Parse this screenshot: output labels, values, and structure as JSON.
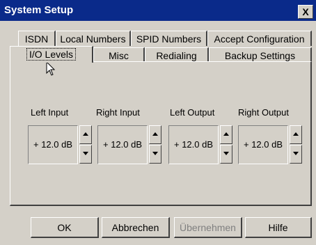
{
  "window": {
    "title": "System Setup",
    "close_glyph": "X"
  },
  "tabs_row1": [
    {
      "label": "ISDN"
    },
    {
      "label": "Local Numbers"
    },
    {
      "label": "SPID Numbers"
    },
    {
      "label": "Accept Configuration"
    }
  ],
  "tabs_row2": [
    {
      "label": "I/O Levels",
      "active": true
    },
    {
      "label": "Misc"
    },
    {
      "label": "Redialing"
    },
    {
      "label": "Backup Settings"
    }
  ],
  "channels": [
    {
      "label": "Left Input",
      "value": "+ 12.0 dB"
    },
    {
      "label": "Right Input",
      "value": "+ 12.0 dB"
    },
    {
      "label": "Left Output",
      "value": "+ 12.0 dB"
    },
    {
      "label": "Right Output",
      "value": "+ 12.0 dB"
    }
  ],
  "buttons": {
    "ok": "OK",
    "cancel": "Abbrechen",
    "apply": "Übernehmen",
    "help": "Hilfe"
  },
  "icons": {
    "cursor": "arrow-cursor-icon",
    "close": "close-icon"
  },
  "colors": {
    "titlebar": "#0a2a8a",
    "face": "#d4d0c8"
  }
}
